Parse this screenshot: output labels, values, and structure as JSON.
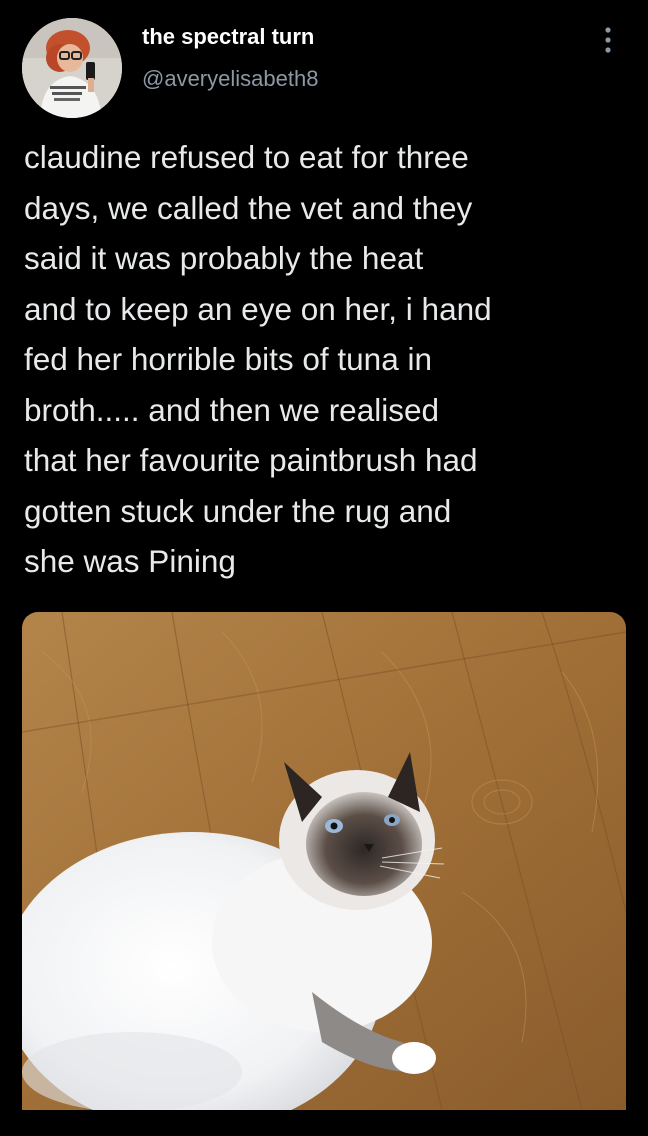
{
  "tweet": {
    "author": {
      "display_name": "the spectral turn",
      "handle": "@averyelisabeth8"
    },
    "text": "claudine refused to eat for three\ndays, we called the vet and they\nsaid it was probably the heat\nand to keep an eye on her, i hand\nfed her horrible bits of tuna in\nbroth..... and then we realised\nthat her favourite paintbrush had\ngotten stuck under the rug and\nshe was Pining",
    "more_icon": "more-vertical-icon",
    "media": {
      "type": "photo",
      "subject": "cat-photo"
    }
  },
  "colors": {
    "background": "#000000",
    "text": "#e7e9ea",
    "secondary_text": "#8b98a5",
    "floor": "#a8793f"
  }
}
